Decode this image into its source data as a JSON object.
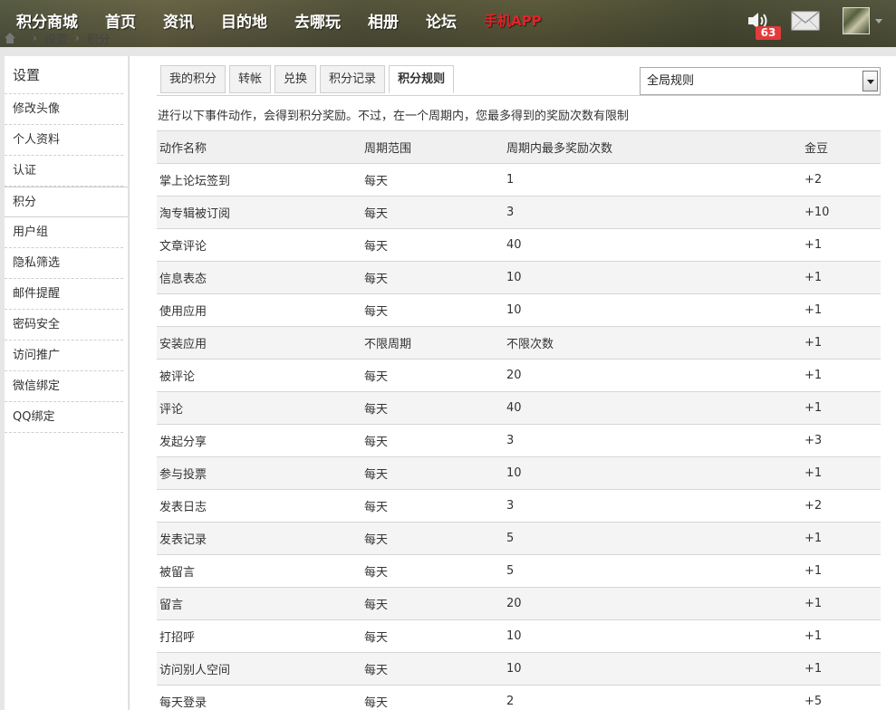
{
  "topnav": {
    "items": [
      "积分商城",
      "首页",
      "资讯",
      "目的地",
      "去哪玩",
      "相册",
      "论坛"
    ],
    "app_label": "手机APP",
    "notification_count": "63"
  },
  "breadcrumb": [
    "设置",
    "积分"
  ],
  "sidebar": {
    "title": "设置",
    "items": [
      "修改头像",
      "个人资料",
      "认证",
      "积分",
      "用户组",
      "隐私筛选",
      "邮件提醒",
      "密码安全",
      "访问推广",
      "微信绑定",
      "QQ绑定"
    ],
    "active": "积分"
  },
  "tabs": [
    "我的积分",
    "转帐",
    "兑换",
    "积分记录",
    "积分规则"
  ],
  "active_tab": "积分规则",
  "rule_select": {
    "value": "全局规则"
  },
  "notice": "进行以下事件动作，会得到积分奖励。不过，在一个周期内，您最多得到的奖励次数有限制",
  "table": {
    "headers": [
      "动作名称",
      "周期范围",
      "周期内最多奖励次数",
      "金豆"
    ],
    "rows": [
      [
        "掌上论坛签到",
        "每天",
        "1",
        "+2"
      ],
      [
        "淘专辑被订阅",
        "每天",
        "3",
        "+10"
      ],
      [
        "文章评论",
        "每天",
        "40",
        "+1"
      ],
      [
        "信息表态",
        "每天",
        "10",
        "+1"
      ],
      [
        "使用应用",
        "每天",
        "10",
        "+1"
      ],
      [
        "安装应用",
        "不限周期",
        "不限次数",
        "+1"
      ],
      [
        "被评论",
        "每天",
        "20",
        "+1"
      ],
      [
        "评论",
        "每天",
        "40",
        "+1"
      ],
      [
        "发起分享",
        "每天",
        "3",
        "+3"
      ],
      [
        "参与投票",
        "每天",
        "10",
        "+1"
      ],
      [
        "发表日志",
        "每天",
        "3",
        "+2"
      ],
      [
        "发表记录",
        "每天",
        "5",
        "+1"
      ],
      [
        "被留言",
        "每天",
        "5",
        "+1"
      ],
      [
        "留言",
        "每天",
        "20",
        "+1"
      ],
      [
        "打招呼",
        "每天",
        "10",
        "+1"
      ],
      [
        "访问别人空间",
        "每天",
        "10",
        "+1"
      ],
      [
        "每天登录",
        "每天",
        "2",
        "+5"
      ]
    ]
  },
  "colors": {
    "app_red": "#e0242a",
    "badge_red": "#e23b3b",
    "header_bg": "#5c6046"
  }
}
